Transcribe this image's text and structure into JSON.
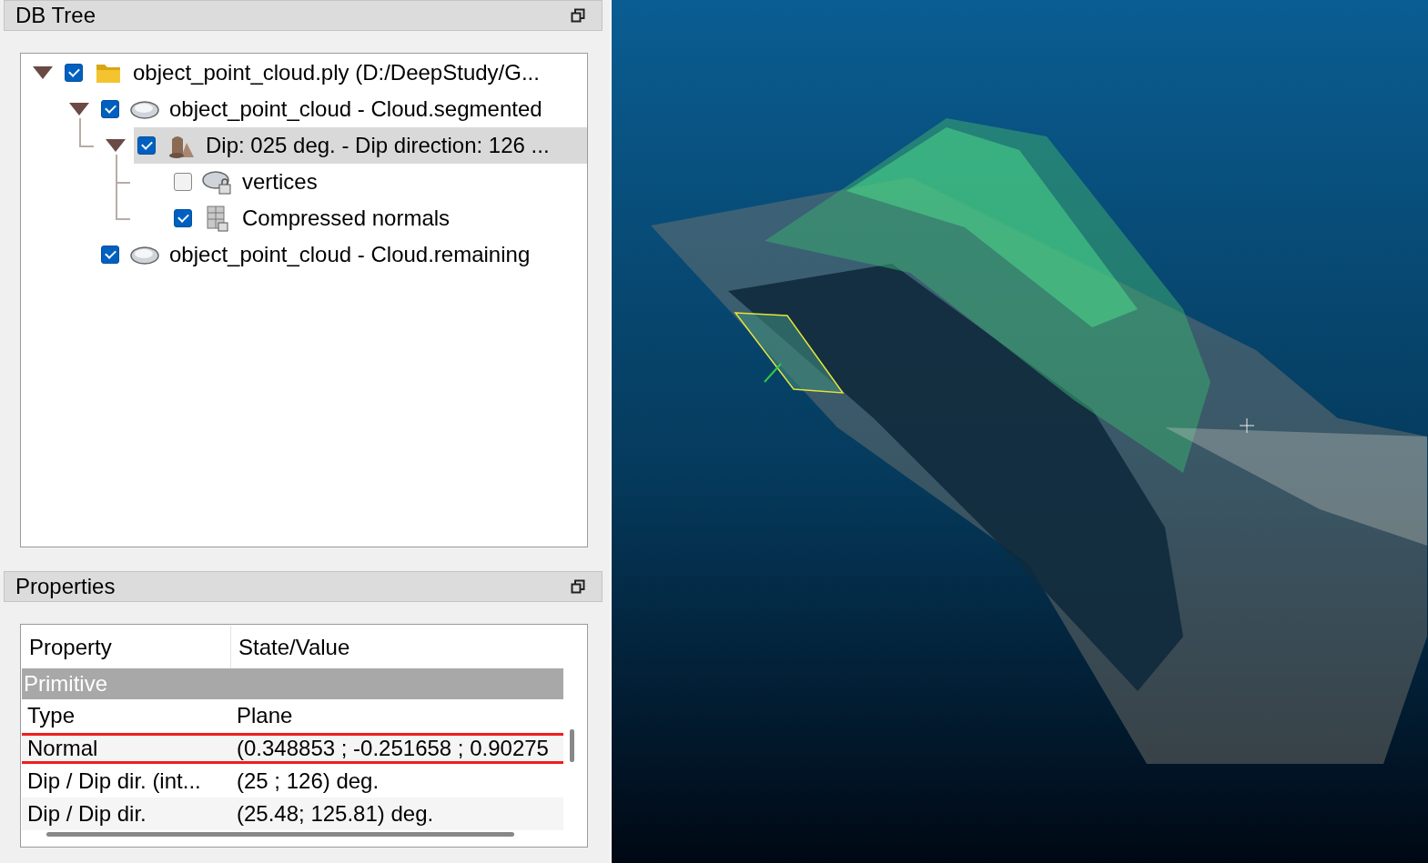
{
  "db_tree": {
    "title": "DB Tree",
    "items": [
      {
        "label": "object_point_cloud.ply (D:/DeepStudy/G...",
        "kind": "folder",
        "checked": true,
        "expanded": true,
        "selected": false,
        "children": [
          {
            "label": "object_point_cloud - Cloud.segmented",
            "kind": "cloud",
            "checked": true,
            "expanded": true,
            "selected": false,
            "children": [
              {
                "label": "Dip: 025 deg. - Dip direction: 126 ...",
                "kind": "plane",
                "checked": true,
                "expanded": true,
                "selected": true,
                "children": [
                  {
                    "label": "vertices",
                    "kind": "locked-cloud",
                    "checked": false,
                    "selected": false
                  },
                  {
                    "label": "Compressed normals",
                    "kind": "normals",
                    "checked": true,
                    "selected": false
                  }
                ]
              }
            ]
          },
          {
            "label": "object_point_cloud - Cloud.remaining",
            "kind": "cloud",
            "checked": true,
            "selected": false
          }
        ]
      }
    ]
  },
  "properties": {
    "title": "Properties",
    "columns": [
      "Property",
      "State/Value"
    ],
    "group": "Primitive",
    "rows": [
      {
        "property": "Type",
        "value": "Plane",
        "highlighted": false
      },
      {
        "property": "Normal",
        "value": "(0.348853 ; -0.251658 ; 0.90275",
        "highlighted": true
      },
      {
        "property": "Dip / Dip dir. (int...",
        "value": "(25 ; 126) deg.",
        "highlighted": false
      },
      {
        "property": "Dip / Dip dir.",
        "value": "(25.48; 125.81) deg.",
        "highlighted": false
      }
    ]
  }
}
